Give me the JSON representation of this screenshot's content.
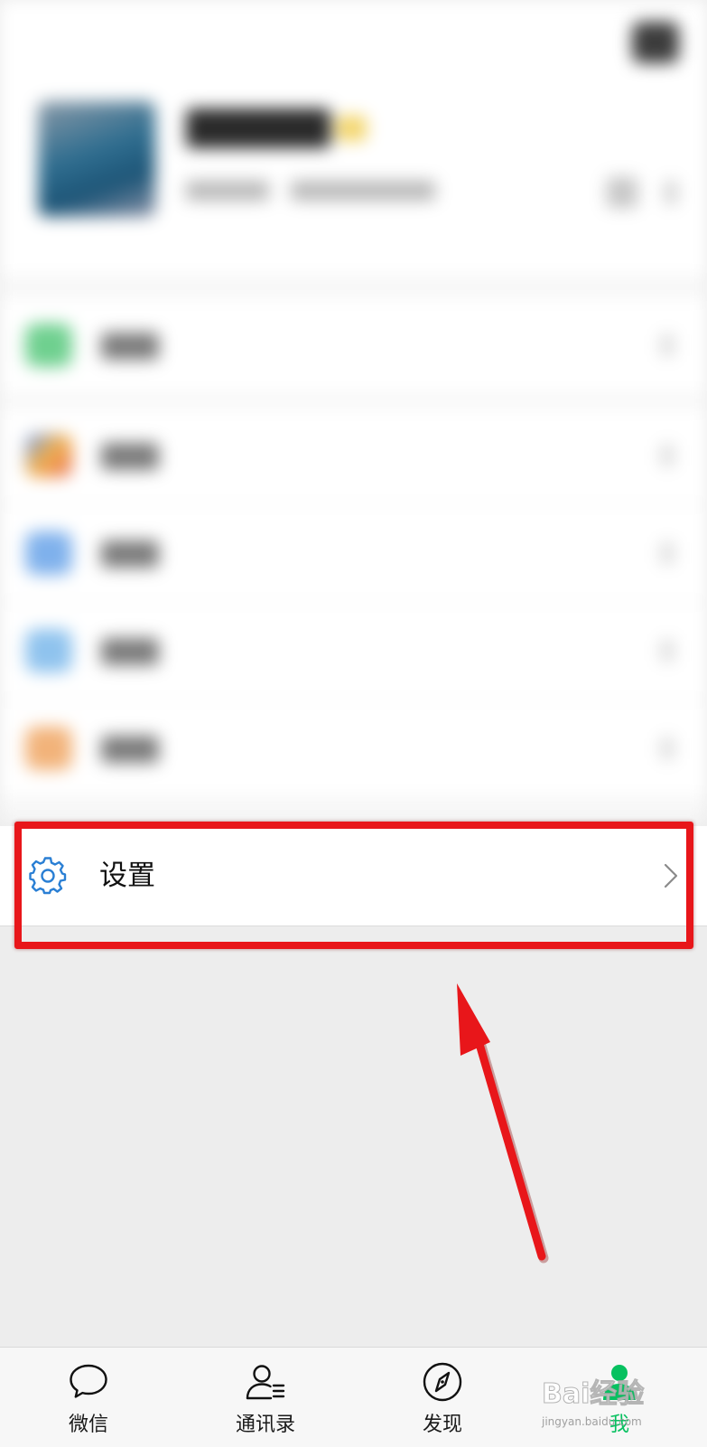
{
  "settings": {
    "label": "设置"
  },
  "tabbar": {
    "tabs": [
      {
        "label": "微信",
        "icon": "chat-bubble-icon",
        "active": false
      },
      {
        "label": "通讯录",
        "icon": "contacts-icon",
        "active": false
      },
      {
        "label": "发现",
        "icon": "compass-icon",
        "active": false
      },
      {
        "label": "我",
        "icon": "person-icon",
        "active": true
      }
    ]
  },
  "watermark": {
    "brand": "Bai经验",
    "url": "jingyan.baidu.com"
  },
  "colors": {
    "accent": "#07c160",
    "settings_icon": "#2a7fd4",
    "annotation": "#e8161a",
    "background": "#ededed"
  }
}
